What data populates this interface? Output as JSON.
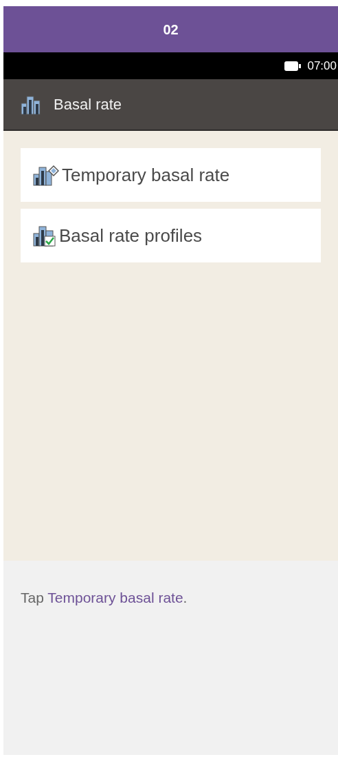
{
  "step": {
    "label": "02"
  },
  "status_bar": {
    "time": "07:00"
  },
  "title_bar": {
    "title": "Basal rate"
  },
  "menu": [
    {
      "label": "Temporary basal rate",
      "kind": "temporary"
    },
    {
      "label": "Basal rate profiles",
      "kind": "profiles"
    }
  ],
  "instruction": {
    "prefix": "Tap ",
    "highlight": "Temporary basal rate",
    "suffix": "."
  }
}
